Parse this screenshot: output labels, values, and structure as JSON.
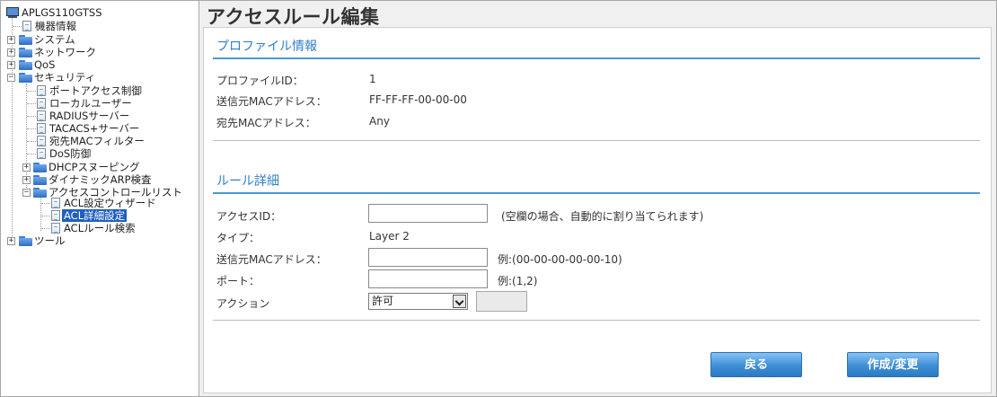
{
  "sidebar": {
    "root": "APLGS110GTSS",
    "items": [
      {
        "label": "機器情報"
      },
      {
        "label": "システム"
      },
      {
        "label": "ネットワーク"
      },
      {
        "label": "QoS"
      },
      {
        "label": "セキュリティ"
      },
      {
        "label": "ポートアクセス制御"
      },
      {
        "label": "ローカルユーザー"
      },
      {
        "label": "RADIUSサーバー"
      },
      {
        "label": "TACACS+サーバー"
      },
      {
        "label": "宛先MACフィルター"
      },
      {
        "label": "DoS防御"
      },
      {
        "label": "DHCPスヌーピング"
      },
      {
        "label": "ダイナミックARP検査"
      },
      {
        "label": "アクセスコントロールリスト"
      },
      {
        "label": "ACL設定ウィザード"
      },
      {
        "label": "ACL詳細設定"
      },
      {
        "label": "ACLルール検索"
      },
      {
        "label": "ツール"
      }
    ],
    "expanders": {
      "plus": "+",
      "minus": "−"
    }
  },
  "main": {
    "title": "アクセスルール編集",
    "profile": {
      "section_title": "プロファイル情報",
      "profile_id_label": "プロファイルID：",
      "profile_id_value": "1",
      "src_mac_label": "送信元MACアドレス：",
      "src_mac_value": "FF-FF-FF-00-00-00",
      "dst_mac_label": "宛先MACアドレス：",
      "dst_mac_value": "Any"
    },
    "rule": {
      "section_title": "ルール詳細",
      "access_id_label": "アクセスID：",
      "access_id_value": "",
      "access_id_hint": "(空欄の場合、自動的に割り当てられます)",
      "type_label": "タイプ：",
      "type_value": "Layer 2",
      "src_mac_label": "送信元MACアドレス：",
      "src_mac_value": "",
      "src_mac_hint": "例:(00-00-00-00-00-10)",
      "port_label": "ポート：",
      "port_value": "",
      "port_hint": "例:(1,2)",
      "action_label": "アクション",
      "action_selected": "許可"
    },
    "buttons": {
      "back": "戻る",
      "submit": "作成/変更"
    }
  },
  "colors": {
    "accent": "#2f80c8",
    "selection": "#1f5fbf",
    "button": "#3e8ed6"
  }
}
